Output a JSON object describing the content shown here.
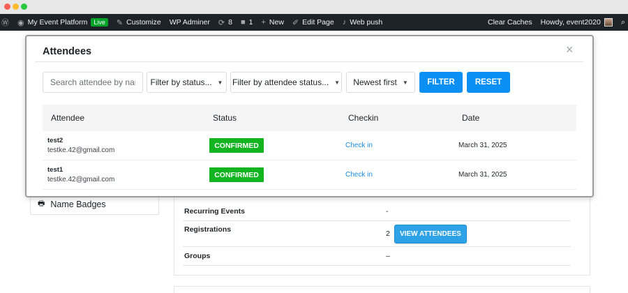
{
  "admin_bar": {
    "wp_logo": "wordpress-icon",
    "site_name": "My Event Platform",
    "live_badge": "Live",
    "customize": "Customize",
    "wp_adminer": "WP Adminer",
    "updates_count": "8",
    "comments_count": "1",
    "new_label": "New",
    "edit_page": "Edit Page",
    "web_push": "Web push",
    "clear_caches": "Clear Caches",
    "howdy": "Howdy, event2020"
  },
  "modal": {
    "title": "Attendees",
    "close_icon": "×",
    "search_placeholder": "Search attendee by name",
    "filter_status": "Filter by status...",
    "filter_attendee_status": "Filter by attendee status...",
    "sort": "Newest first",
    "filter_button": "FILTER",
    "reset_button": "RESET",
    "columns": [
      "Attendee",
      "Status",
      "Checkin",
      "Date"
    ],
    "rows": [
      {
        "name": "test2",
        "email": "testke.42@gmail.com",
        "status": "CONFIRMED",
        "checkin": "Check in",
        "date": "March 31, 2025"
      },
      {
        "name": "test1",
        "email": "testke.42@gmail.com",
        "status": "CONFIRMED",
        "checkin": "Check in",
        "date": "March 31, 2025"
      }
    ]
  },
  "background": {
    "name_badges": "Name Badges",
    "details": [
      {
        "label": "Recurring Events",
        "value": "-"
      },
      {
        "label": "Registrations",
        "value": "2",
        "button": "VIEW ATTENDEES"
      },
      {
        "label": "Groups",
        "value": "–"
      }
    ]
  },
  "colors": {
    "admin_bar_bg": "#1d2327",
    "primary_button": "#0a8ff5",
    "confirmed_badge": "#12b41f",
    "link": "#1a8ce0",
    "live_badge": "#00a32a"
  }
}
